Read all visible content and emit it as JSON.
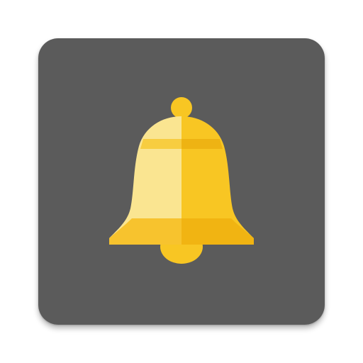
{
  "app_icon": {
    "icon": "bell-icon",
    "colors": {
      "tile_background": "#5b5b5b",
      "bell_light": "#fae591",
      "bell_main": "#f8c623",
      "bell_shadow": "#f1b412",
      "bell_band_light": "#f7cd40",
      "bell_band_dark": "#eeb313",
      "clapper": "#f8c623"
    }
  }
}
